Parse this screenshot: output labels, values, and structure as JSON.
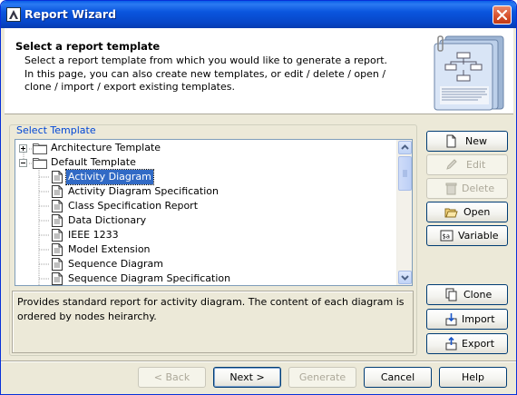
{
  "window": {
    "title": "Report Wizard"
  },
  "header": {
    "title": "Select a report template",
    "description": "Select a report template from which you would like to generate a report. In this page, you can also create new templates, or edit / delete / open / clone / import / export existing templates."
  },
  "template_group": {
    "label": "Select Template"
  },
  "tree": {
    "folders": [
      {
        "label": "Architecture Template",
        "expanded": false
      },
      {
        "label": "Default Template",
        "expanded": true
      }
    ],
    "items": [
      {
        "label": "Activity Diagram",
        "selected": true
      },
      {
        "label": "Activity Diagram Specification",
        "selected": false
      },
      {
        "label": "Class Specification Report",
        "selected": false
      },
      {
        "label": "Data Dictionary",
        "selected": false
      },
      {
        "label": "IEEE 1233",
        "selected": false
      },
      {
        "label": "Model Extension",
        "selected": false
      },
      {
        "label": "Sequence Diagram",
        "selected": false
      },
      {
        "label": "Sequence Diagram Specification",
        "selected": false
      }
    ]
  },
  "description": {
    "text": "Provides standard report for activity diagram. The content of each diagram is ordered by nodes heirarchy."
  },
  "side_buttons": {
    "new": "New",
    "edit": "Edit",
    "delete": "Delete",
    "open": "Open",
    "variable": "Variable",
    "clone": "Clone",
    "import": "Import",
    "export": "Export"
  },
  "footer_buttons": {
    "back": "< Back",
    "next": "Next >",
    "generate": "Generate",
    "cancel": "Cancel",
    "help": "Help"
  },
  "colors": {
    "titlebar": "#0a56de",
    "selection": "#316ac5",
    "accent_text": "#0046d5"
  }
}
